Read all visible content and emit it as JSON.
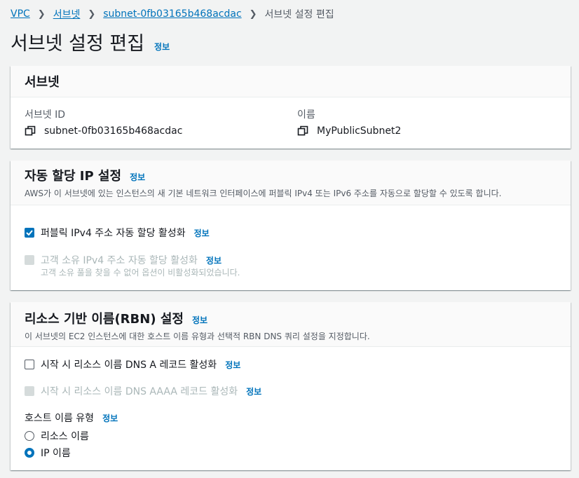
{
  "breadcrumb": {
    "items": [
      "VPC",
      "서브넷",
      "subnet-0fb03165b468acdac"
    ],
    "current": "서브넷 설정 편집"
  },
  "page": {
    "title": "서브넷 설정 편집",
    "info": "정보"
  },
  "subnet_panel": {
    "title": "서브넷",
    "id_label": "서브넷 ID",
    "id_value": "subnet-0fb03165b468acdac",
    "name_label": "이름",
    "name_value": "MyPublicSubnet2"
  },
  "auto_assign_panel": {
    "title": "자동 할당 IP 설정",
    "info": "정보",
    "description": "AWS가 이 서브넷에 있는 인스턴스의 새 기본 네트워크 인터페이스에 퍼블릭 IPv4 또는 IPv6 주소를 자동으로 할당할 수 있도록 합니다.",
    "options": [
      {
        "label": "퍼블릭 IPv4 주소 자동 할당 활성화",
        "info": "정보",
        "checked": true,
        "disabled": false
      },
      {
        "label": "고객 소유 IPv4 주소 자동 할당 활성화",
        "info": "정보",
        "checked": false,
        "disabled": true,
        "hint": "고객 소유 풀을 찾을 수 없어 옵션이 비활성화되었습니다."
      }
    ]
  },
  "rbn_panel": {
    "title": "리소스 기반 이름(RBN) 설정",
    "info": "정보",
    "description": "이 서브넷의 EC2 인스턴스에 대한 호스트 이름 유형과 선택적 RBN DNS 쿼리 설정을 지정합니다.",
    "options": [
      {
        "label": "시작 시 리소스 이름 DNS A 레코드 활성화",
        "info": "정보",
        "checked": false,
        "disabled": false
      },
      {
        "label": "시작 시 리소스 이름 DNS AAAA 레코드 활성화",
        "info": "정보",
        "checked": false,
        "disabled": true
      }
    ],
    "hostname_type": {
      "label": "호스트 이름 유형",
      "info": "정보",
      "choices": [
        "리소스 이름",
        "IP 이름"
      ],
      "selected": "IP 이름"
    }
  },
  "colors": {
    "link": "#0073bb",
    "checkbox": "#0073bb",
    "disabled": "#aab7b8"
  },
  "icons": {
    "copy": "copy-icon",
    "check": "check-icon"
  }
}
